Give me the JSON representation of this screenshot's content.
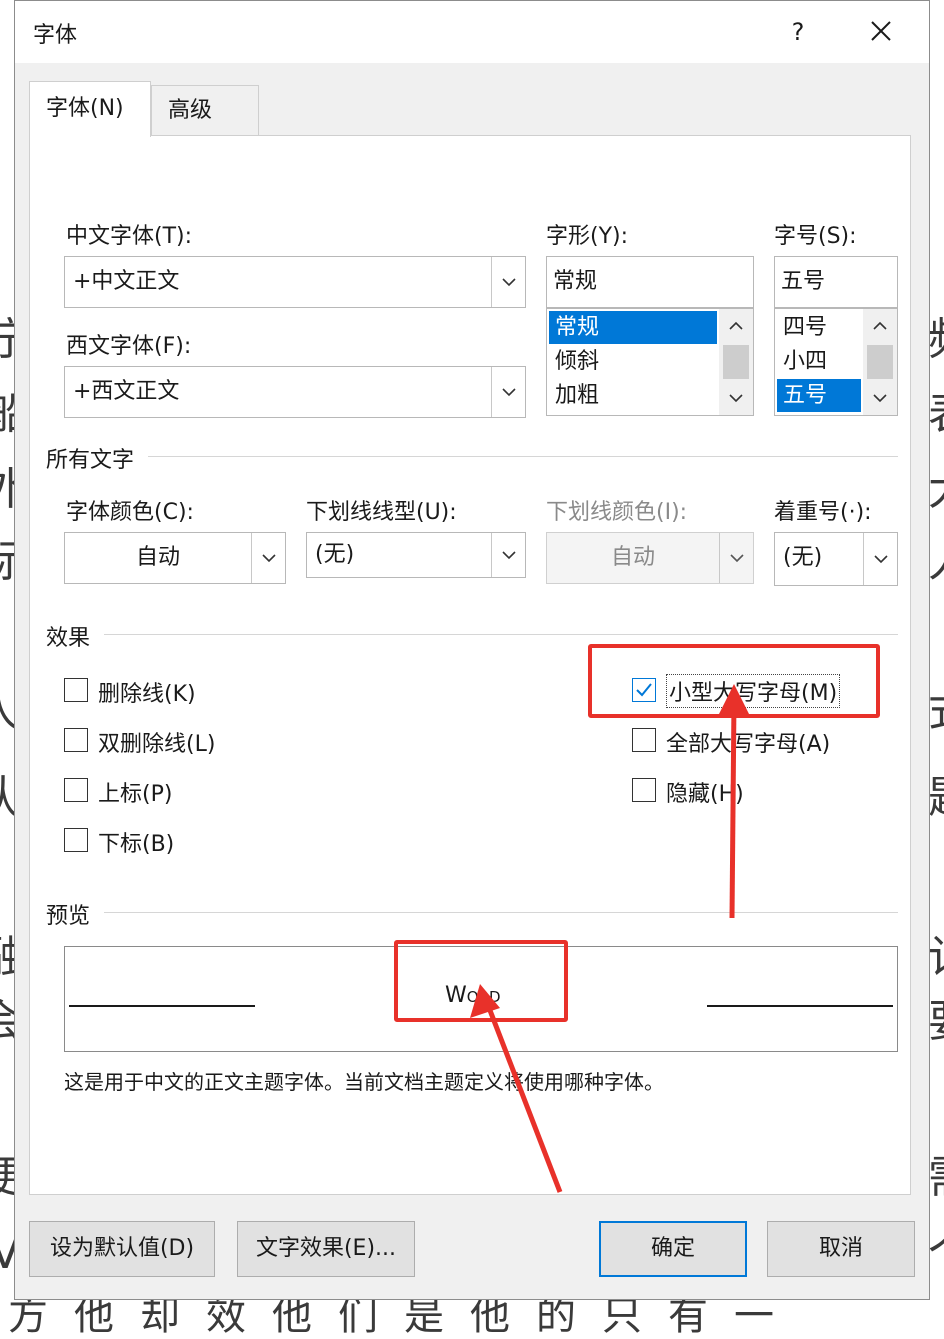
{
  "background": {
    "left_chars": [
      "宁",
      "船",
      "外",
      "际",
      "人",
      "认",
      "融",
      "会",
      "便",
      "V"
    ],
    "right_chars": [
      "频",
      "表",
      "大",
      "人",
      "式",
      "题",
      "计",
      "要",
      "需",
      "个"
    ],
    "bottom_text": "方他却效他们是他的只有一"
  },
  "dialog": {
    "title": "字体",
    "help_label": "?",
    "tabs": [
      "字体(N)",
      "高级(V)"
    ]
  },
  "fonts": {
    "chinese_font_label": "中文字体(T):",
    "chinese_font_value": "+中文正文",
    "western_font_label": "西文字体(F):",
    "western_font_value": "+西文正文",
    "style_label": "字形(Y):",
    "style_value": "常规",
    "style_options": [
      "常规",
      "倾斜",
      "加粗"
    ],
    "style_selected": "常规",
    "size_label": "字号(S):",
    "size_value": "五号",
    "size_options": [
      "四号",
      "小四",
      "五号"
    ],
    "size_selected": "五号"
  },
  "all_text": {
    "group_title": "所有文字",
    "color_label": "字体颜色(C):",
    "color_value": "自动",
    "underline_label": "下划线线型(U):",
    "underline_value": "(无)",
    "underline_color_label": "下划线颜色(I):",
    "underline_color_value": "自动",
    "emphasis_label": "着重号(·):",
    "emphasis_value": "(无)"
  },
  "effects": {
    "group_title": "效果",
    "strikethrough": {
      "label": "删除线(K)",
      "checked": false
    },
    "double_strikethrough": {
      "label": "双删除线(L)",
      "checked": false
    },
    "superscript": {
      "label": "上标(P)",
      "checked": false
    },
    "subscript": {
      "label": "下标(B)",
      "checked": false
    },
    "small_caps": {
      "label": "小型大写字母(M)",
      "checked": true
    },
    "all_caps": {
      "label": "全部大写字母(A)",
      "checked": false
    },
    "hidden": {
      "label": "隐藏(H)",
      "checked": false
    }
  },
  "preview": {
    "group_title": "预览",
    "sample_first": "W",
    "sample_rest": "ORD",
    "description": "这是用于中文的正文主题字体。当前文档主题定义将使用哪种字体。"
  },
  "buttons": {
    "set_default": "设为默认值(D)",
    "text_effects": "文字效果(E)...",
    "ok": "确定",
    "cancel": "取消"
  },
  "colors": {
    "accent": "#0078d7",
    "annotation_red": "#e8312a"
  }
}
